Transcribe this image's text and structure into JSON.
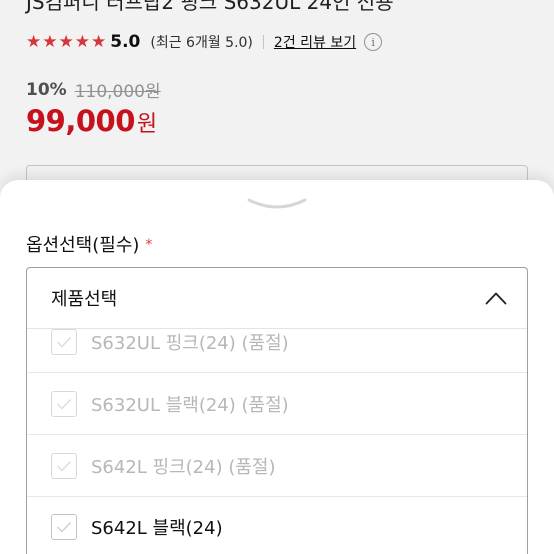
{
  "product": {
    "title_fragment": "JS컴퍼니 터프탑2 핑크 S632UL 24인 전용",
    "rating": {
      "stars": 5,
      "value": "5.0",
      "recent": "(최근 6개월 5.0)",
      "review_link": "2건 리뷰 보기",
      "info_glyph": "i"
    },
    "price": {
      "discount_rate": "10%",
      "original": "110,000원",
      "sale": "99,000",
      "sale_unit": "원"
    }
  },
  "sheet": {
    "option_label": "옵션선택(필수)",
    "required_mark": "*",
    "select": {
      "title": "제품선택",
      "expanded": true,
      "options": [
        {
          "label": "S632UL 핑크(24) (품절)",
          "sold_out": true
        },
        {
          "label": "S632UL 블랙(24) (품절)",
          "sold_out": true
        },
        {
          "label": "S642L 핑크(24) (품절)",
          "sold_out": true
        },
        {
          "label": "S642L 블랙(24)",
          "sold_out": false
        }
      ]
    }
  },
  "colors": {
    "star": "#e0393f",
    "sale_price": "#d2121e",
    "required": "#e0393f",
    "sold_out_text": "#b7b7b7"
  },
  "icons": {
    "rating": "star-icon",
    "info": "info-icon",
    "handle": "sheet-handle-icon",
    "collapse": "chevron-up-icon",
    "option_check": "check-icon"
  }
}
